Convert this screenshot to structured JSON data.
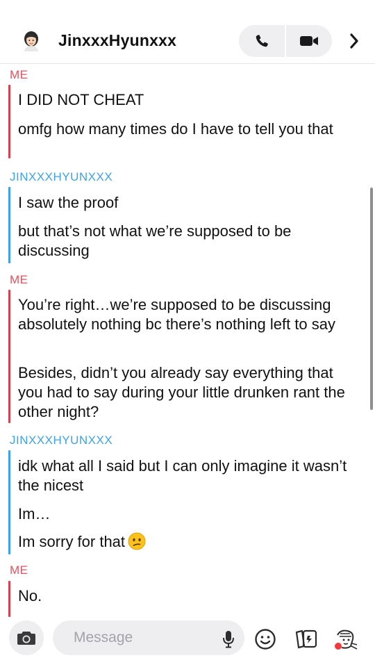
{
  "header": {
    "contact_name": "JinxxxHyunxxx",
    "avatar_icon": "bitmoji-avatar",
    "call_icon": "phone-icon",
    "video_icon": "video-camera-icon",
    "more_icon": "chevron-right-icon"
  },
  "colors": {
    "me": "#d9414f",
    "them": "#3ea2ea"
  },
  "messages": [
    {
      "sender": "ME",
      "side": "me",
      "texts": [
        "I DID NOT CHEAT",
        "omfg how many times do I have to tell you that"
      ]
    },
    {
      "sender": "JINXXXHYUNXXX",
      "side": "them",
      "texts": [
        "I saw the proof",
        "but that’s not what we’re supposed to be discussing"
      ]
    },
    {
      "sender": "ME",
      "side": "me",
      "texts": [
        "You’re right…we’re supposed to be discussing absolutely nothing bc there’s nothing left to say",
        "Besides, didn’t you already say everything that you had to say during your little drunken rant the other night?"
      ]
    },
    {
      "sender": "JINXXXHYUNXXX",
      "side": "them",
      "texts": [
        "idk what all I said but I can only imagine it wasn’t the nicest",
        "Im…",
        "Im sorry for that"
      ]
    },
    {
      "sender": "ME",
      "side": "me",
      "texts": [
        "No."
      ]
    }
  ],
  "emoji": {
    "confused": "confused-face-emoji"
  },
  "composer": {
    "placeholder": "Message",
    "camera_icon": "camera-icon",
    "mic_icon": "microphone-icon",
    "emoji_icon": "smiley-icon",
    "sticker_icon": "sticker-icon",
    "bitmoji_icon": "bitmoji-icon"
  }
}
